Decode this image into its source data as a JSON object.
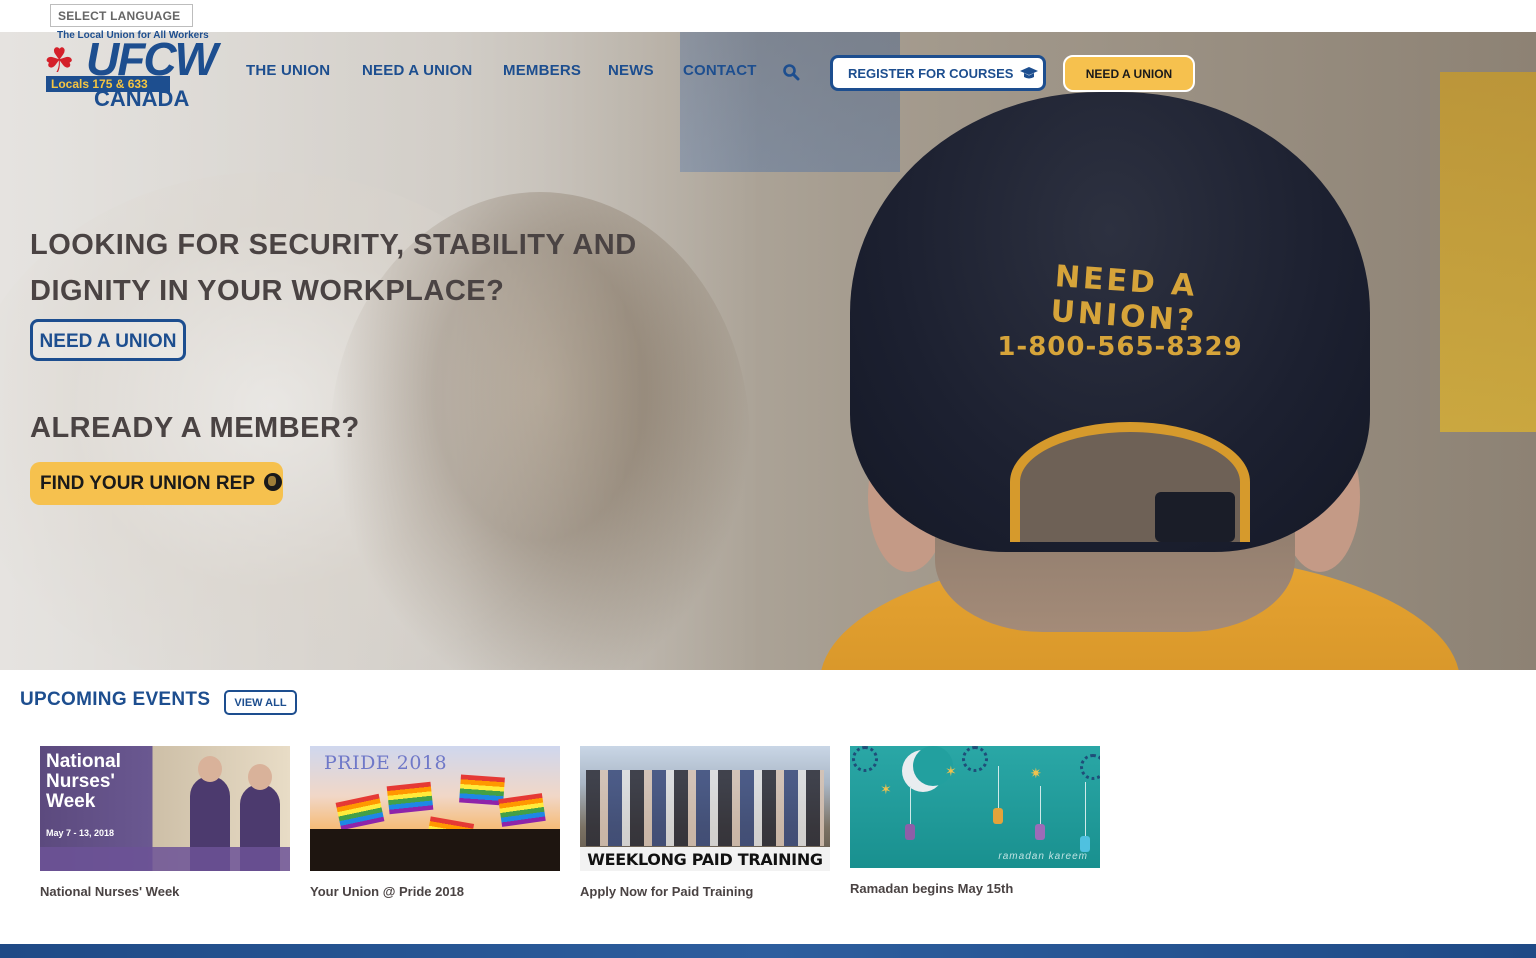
{
  "language": {
    "label": "SELECT LANGUAGE"
  },
  "logo": {
    "tagline": "The Local Union for All Workers",
    "name": "UFCW",
    "locals": "Locals 175 & 633",
    "country": "CANADA"
  },
  "nav": {
    "items": [
      "THE UNION",
      "NEED A UNION",
      "MEMBERS",
      "NEWS",
      "CONTACT"
    ],
    "register_label": "REGISTER FOR COURSES",
    "need_union_label": "NEED A UNION"
  },
  "hero": {
    "headline": "LOOKING FOR SECURITY, STABILITY AND DIGNITY IN YOUR WORKPLACE?",
    "need_union_button": "NEED A UNION",
    "member_heading": "ALREADY A MEMBER?",
    "find_rep_button": "FIND YOUR UNION REP",
    "cap_line1": "NEED A UNION?",
    "cap_line2": "1-800-565-8329"
  },
  "events": {
    "title": "UPCOMING EVENTS",
    "view_all": "VIEW ALL",
    "cards": [
      {
        "title": "National Nurses' Week",
        "image_text": "National Nurses' Week",
        "image_date": "May 7 - 13, 2018"
      },
      {
        "title": "Your Union @ Pride 2018",
        "image_text": "PRIDE 2018"
      },
      {
        "title": "Apply Now for Paid Training",
        "image_text": "WEEKLONG PAID TRAINING"
      },
      {
        "title": "Ramadan begins May 15th",
        "image_text": "ramadan kareem"
      }
    ]
  },
  "colors": {
    "brand_blue": "#1d4e8f",
    "accent_yellow": "#f6c14e",
    "heading_gray": "#4a4343"
  },
  "icons": [
    "search-icon",
    "graduation-cap-icon",
    "globe-icon",
    "maple-leaf-icon"
  ]
}
